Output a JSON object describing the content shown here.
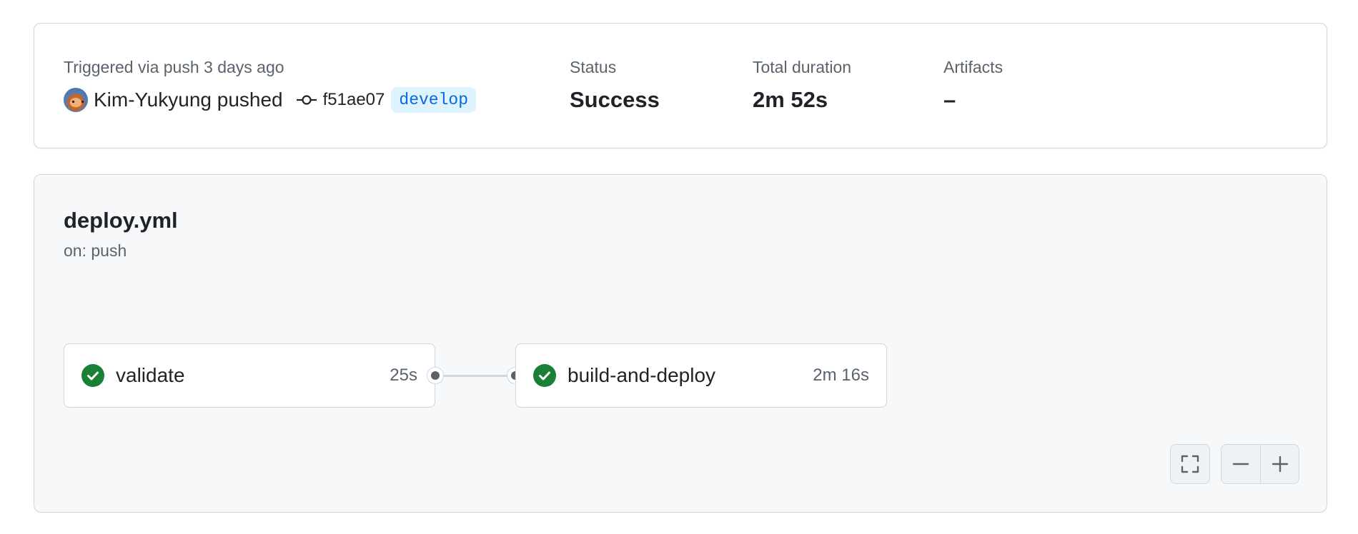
{
  "summary": {
    "trigger_label": "Triggered via push 3 days ago",
    "actor": "Kim-Yukyung",
    "action": "pushed",
    "commit_sha": "f51ae07",
    "branch": "develop",
    "status_label": "Status",
    "status_value": "Success",
    "duration_label": "Total duration",
    "duration_value": "2m 52s",
    "artifacts_label": "Artifacts",
    "artifacts_value": "–"
  },
  "workflow": {
    "file_name": "deploy.yml",
    "trigger": "on: push",
    "jobs": [
      {
        "name": "validate",
        "duration": "25s",
        "status": "success"
      },
      {
        "name": "build-and-deploy",
        "duration": "2m 16s",
        "status": "success"
      }
    ]
  },
  "colors": {
    "success": "#1a7f37",
    "branch_bg": "#ddf4ff",
    "branch_fg": "#0969da",
    "border": "#d0d7de",
    "muted_text": "#59636e"
  },
  "icons": {
    "commit": "git-commit-icon",
    "job_status": "check-circle-icon",
    "fullscreen": "fullscreen-icon",
    "zoom_out": "minus-icon",
    "zoom_in": "plus-icon"
  }
}
